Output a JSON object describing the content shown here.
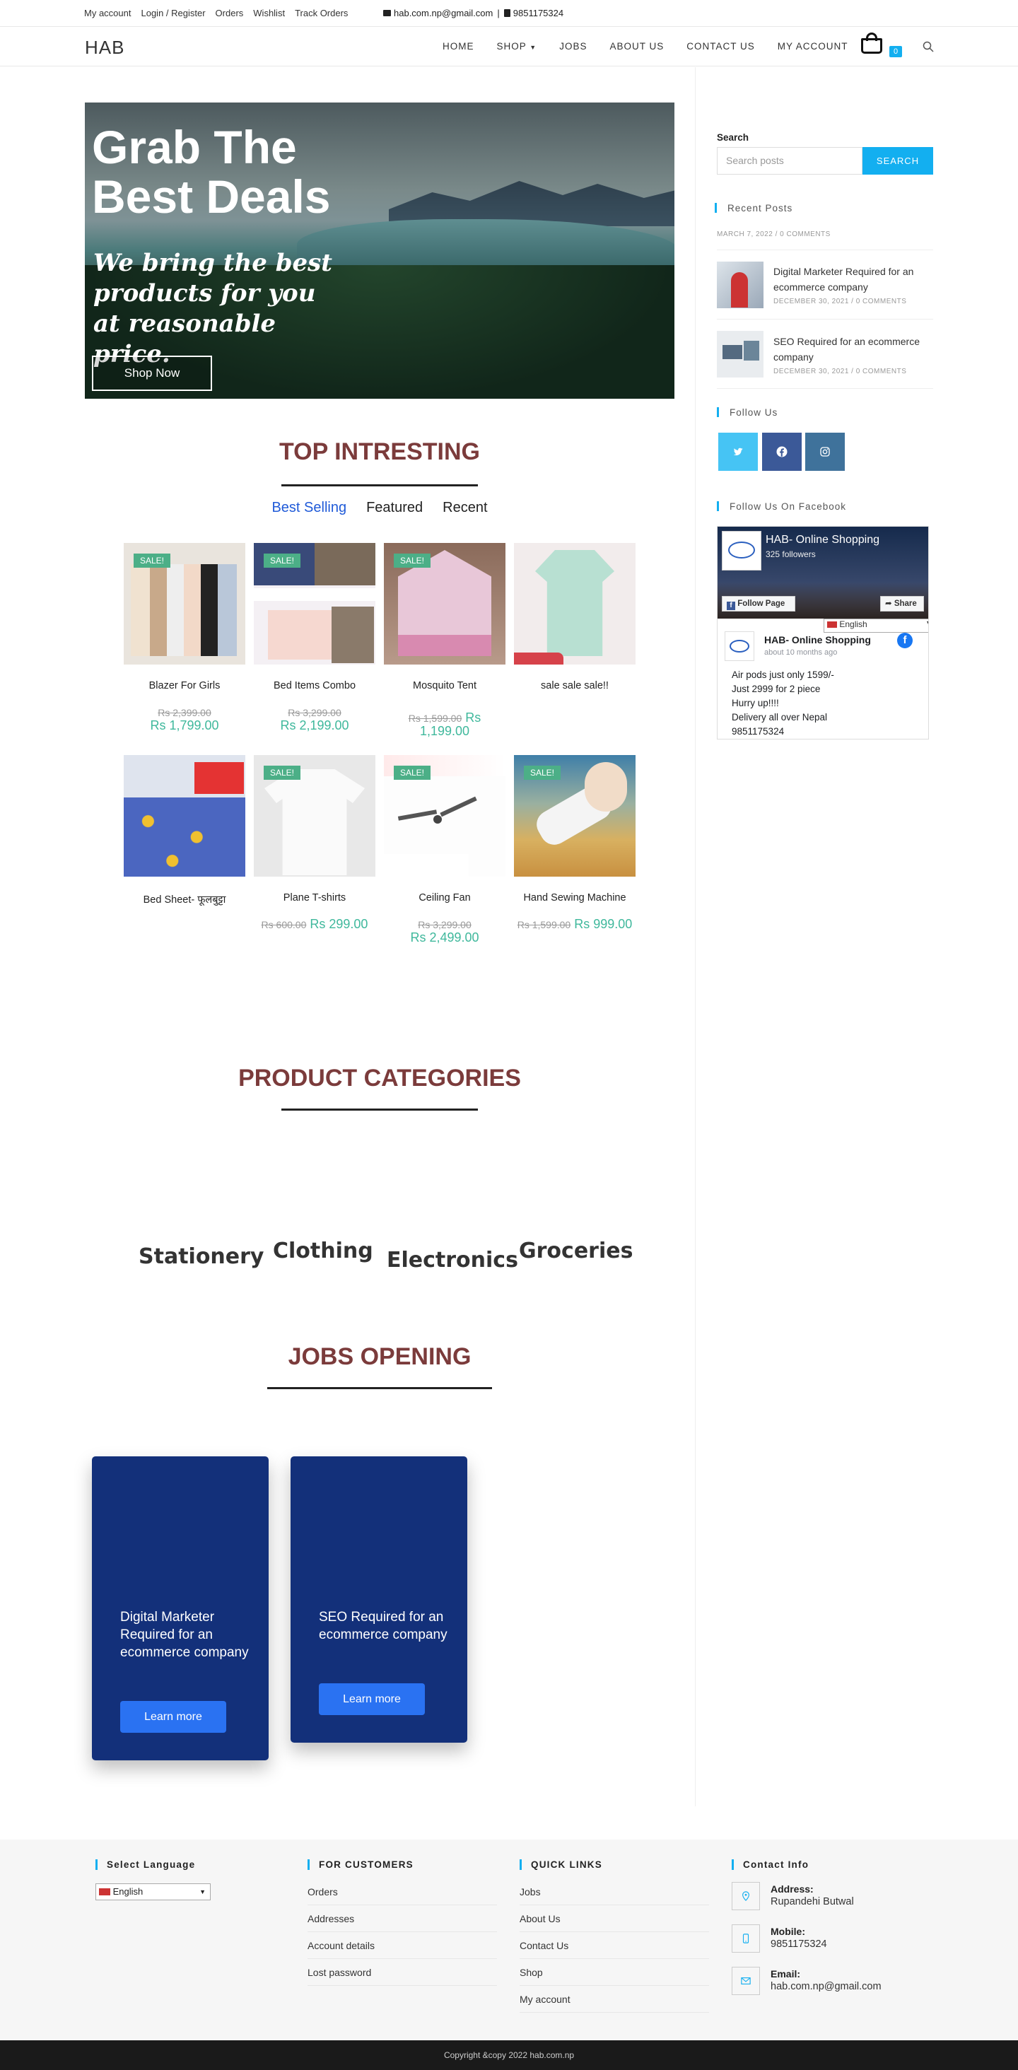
{
  "topbar": {
    "links": [
      "My account",
      "Login / Register",
      "Orders",
      "Wishlist",
      "Track Orders"
    ],
    "email": "hab.com.np@gmail.com",
    "phone": "9851175324"
  },
  "header": {
    "logo": "HAB",
    "nav": [
      "HOME",
      "SHOP",
      "JOBS",
      "ABOUT US",
      "CONTACT US",
      "MY ACCOUNT"
    ],
    "cart_count": "0"
  },
  "hero": {
    "title_line1": "Grab The",
    "title_line2": "Best Deals",
    "tagline": "We bring the best products for you at reasonable price.",
    "button": "Shop Now"
  },
  "sections": {
    "top_title": "TOP INTRESTING",
    "categories_title": "PRODUCT CATEGORIES",
    "jobs_title": "JOBS OPENING"
  },
  "tabs": [
    "Best Selling",
    "Featured",
    "Recent"
  ],
  "products": [
    {
      "name": "Blazer For Girls",
      "sale": "SALE!",
      "old": "Rs 2,399.00",
      "price": "Rs 1,799.00"
    },
    {
      "name": "Bed Items Combo",
      "sale": "SALE!",
      "old": "Rs 3,299.00",
      "price": "Rs 2,199.00"
    },
    {
      "name": "Mosquito Tent",
      "sale": "SALE!",
      "old": "Rs 1,599.00",
      "price": "Rs 1,199.00"
    },
    {
      "name": "sale sale sale!!",
      "sale": "",
      "old": "",
      "price": ""
    },
    {
      "name": "Bed Sheet- फूलबुट्टा",
      "sale": "",
      "old": "",
      "price": ""
    },
    {
      "name": "Plane T-shirts",
      "sale": "SALE!",
      "old": "Rs 600.00",
      "price": "Rs 299.00"
    },
    {
      "name": "Ceiling Fan",
      "sale": "SALE!",
      "old": "Rs 3,299.00",
      "price": "Rs 2,499.00"
    },
    {
      "name": "Hand Sewing Machine",
      "sale": "SALE!",
      "old": "Rs 1,599.00",
      "price": "Rs 999.00"
    }
  ],
  "categories": [
    "Stationery",
    "Clothing",
    "Electronics",
    "Groceries"
  ],
  "jobs": [
    {
      "title": "Digital Marketer Required for an ecommerce company",
      "button": "Learn more"
    },
    {
      "title": "SEO Required for an ecommerce company",
      "button": "Learn more"
    }
  ],
  "sidebar": {
    "search_label": "Search",
    "search_placeholder": "Search posts",
    "search_button": "SEARCH",
    "recent_posts_title": "Recent Posts",
    "first_meta": "MARCH 7, 2022 / 0 COMMENTS",
    "posts": [
      {
        "title": "Digital Marketer Required for an ecommerce company",
        "meta": "DECEMBER 30, 2021 / 0 COMMENTS"
      },
      {
        "title": "SEO Required for an ecommerce company",
        "meta": "DECEMBER 30, 2021 / 0 COMMENTS"
      }
    ],
    "follow_title": "Follow Us",
    "follow_fb_title": "Follow Us On Facebook",
    "fb": {
      "page_name": "HAB- Online Shopping",
      "followers": "325 followers",
      "follow_btn": "Follow Page",
      "share_btn": "Share",
      "post_author": "HAB- Online Shopping",
      "post_time": "about 10 months ago",
      "post_lines": [
        "Air pods just only 1599/-",
        "Just 2999 for 2 piece",
        "Hurry up!!!!",
        "Delivery all over Nepal",
        "9851175324"
      ],
      "lang": "English"
    },
    "social_colors": {
      "twitter": "#46c4f4",
      "facebook": "#3b5998",
      "instagram": "#3f729b"
    }
  },
  "footer": {
    "lang_title": "Select Language",
    "lang_value": "English",
    "customers_title": "FOR CUSTOMERS",
    "customers_links": [
      "Orders",
      "Addresses",
      "Account details",
      "Lost password"
    ],
    "quick_title": "QUICK LINKS",
    "quick_links": [
      "Jobs",
      "About Us",
      "Contact Us",
      "Shop",
      "My account"
    ],
    "contact_title": "Contact Info",
    "address_label": "Address:",
    "address": "Rupandehi Butwal",
    "mobile_label": "Mobile:",
    "mobile": "9851175324",
    "email_label": "Email:",
    "email": "hab.com.np@gmail.com",
    "copyright": "Copyright &copy 2022 hab.com.np"
  }
}
